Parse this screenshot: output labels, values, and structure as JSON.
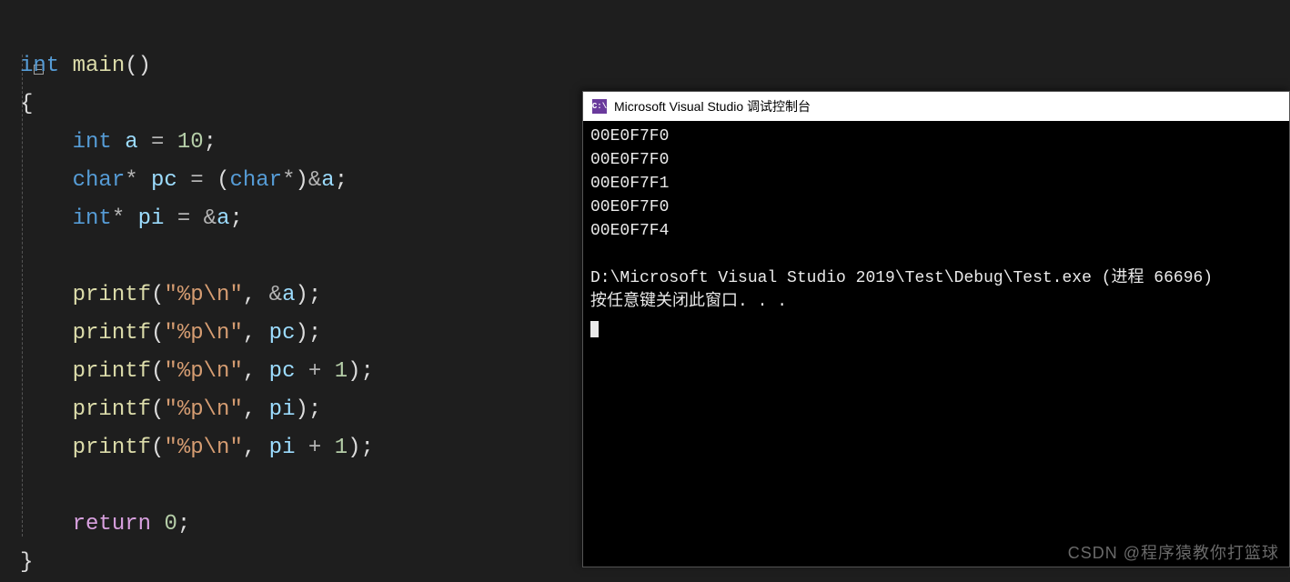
{
  "code": {
    "tokens": {
      "kw_int": "int",
      "kw_char": "char",
      "fn_main": "main",
      "fn_printf": "printf",
      "kw_return": "return",
      "id_a": "a",
      "id_pc": "pc",
      "id_pi": "pi",
      "num_10": "10",
      "num_0": "0",
      "num_1": "1",
      "str_fmt": "\"%p\\n\"",
      "lparen": "(",
      "rparen": ")",
      "lbrace": "{",
      "rbrace": "}",
      "star": "*",
      "amp": "&",
      "eq": "=",
      "semi": ";",
      "comma": ",",
      "plus": "+",
      "indent1": "    ",
      "indent2": "        "
    }
  },
  "console": {
    "title": "Microsoft Visual Studio 调试控制台",
    "icon_label": "C:\\",
    "lines": [
      "00E0F7F0",
      "00E0F7F0",
      "00E0F7F1",
      "00E0F7F0",
      "00E0F7F4",
      "",
      "D:\\Microsoft Visual Studio 2019\\Test\\Debug\\Test.exe (进程 66696)",
      "按任意键关闭此窗口. . ."
    ]
  },
  "watermark": "CSDN @程序猿教你打篮球"
}
